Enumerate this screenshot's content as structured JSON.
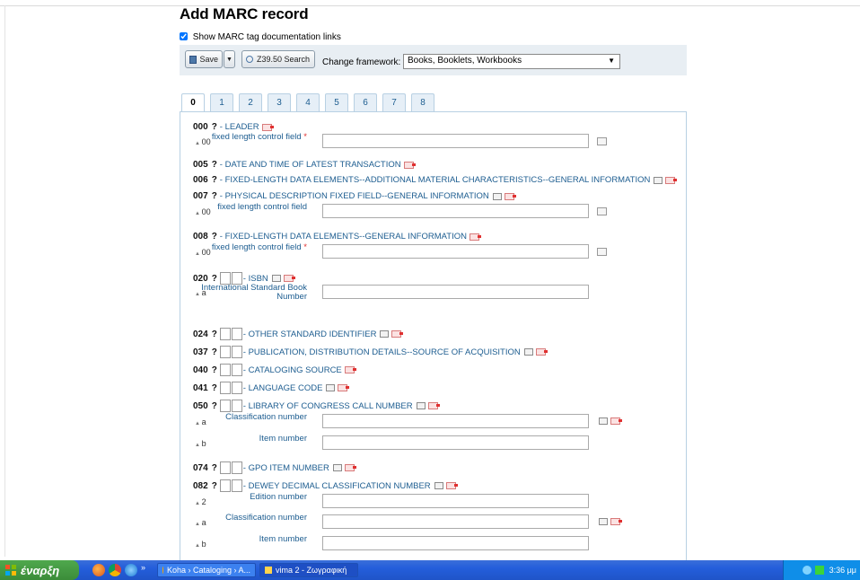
{
  "page": {
    "title": "Add MARC record",
    "show_doc_label": "Show MARC tag documentation links",
    "show_doc_checked": true
  },
  "toolbar": {
    "save_label": "Save",
    "z3950_label": "Z39.50 Search",
    "framework_label": "Change framework:",
    "framework_value": "Books, Booklets, Workbooks"
  },
  "tabs": [
    "0",
    "1",
    "2",
    "3",
    "4",
    "5",
    "6",
    "7",
    "8"
  ],
  "active_tab": "0",
  "fields": [
    {
      "tag": "000",
      "q": "?",
      "name": "- LEADER",
      "subs": [
        {
          "code": "00",
          "label": "fixed length control field",
          "required": true,
          "value": ""
        }
      ]
    },
    {
      "tag": "005",
      "q": "?",
      "name": "- DATE AND TIME OF LATEST TRANSACTION",
      "subs": []
    },
    {
      "tag": "006",
      "q": "?",
      "name": "- FIXED-LENGTH DATA ELEMENTS--ADDITIONAL MATERIAL CHARACTERISTICS--GENERAL INFORMATION",
      "subs": []
    },
    {
      "tag": "007",
      "q": "?",
      "name": "- PHYSICAL DESCRIPTION FIXED FIELD--GENERAL INFORMATION",
      "subs": [
        {
          "code": "00",
          "label": "fixed length control field",
          "required": false,
          "value": ""
        }
      ]
    },
    {
      "tag": "008",
      "q": "?",
      "name": "- FIXED-LENGTH DATA ELEMENTS--GENERAL INFORMATION",
      "subs": [
        {
          "code": "00",
          "label": "fixed length control field",
          "required": true,
          "value": ""
        }
      ]
    },
    {
      "tag": "020",
      "q": "?",
      "name": "- ISBN",
      "subs": [
        {
          "code": "a",
          "label": "International Standard Book Number",
          "value": ""
        }
      ]
    },
    {
      "tag": "024",
      "q": "?",
      "name": "- OTHER STANDARD IDENTIFIER",
      "subs": []
    },
    {
      "tag": "037",
      "q": "?",
      "name": "- PUBLICATION, DISTRIBUTION DETAILS--SOURCE OF ACQUISITION",
      "subs": []
    },
    {
      "tag": "040",
      "q": "?",
      "name": "- CATALOGING SOURCE",
      "subs": []
    },
    {
      "tag": "041",
      "q": "?",
      "name": "- LANGUAGE CODE",
      "subs": []
    },
    {
      "tag": "050",
      "q": "?",
      "name": "- LIBRARY OF CONGRESS CALL NUMBER",
      "subs": [
        {
          "code": "a",
          "label": "Classification number",
          "value": ""
        },
        {
          "code": "b",
          "label": "Item number",
          "value": ""
        }
      ]
    },
    {
      "tag": "074",
      "q": "?",
      "name": "- GPO ITEM NUMBER",
      "subs": []
    },
    {
      "tag": "082",
      "q": "?",
      "name": "- DEWEY DECIMAL CLASSIFICATION NUMBER",
      "subs": [
        {
          "code": "2",
          "label": "Edition number",
          "value": ""
        },
        {
          "code": "a",
          "label": "Classification number",
          "value": ""
        },
        {
          "code": "b",
          "label": "Item number",
          "value": ""
        }
      ]
    }
  ],
  "taskbar": {
    "start_label": "έναρξη",
    "task1": "Koha › Cataloging › A...",
    "task2": "vima 2 - Ζωγραφική",
    "clock": "3:36 μμ"
  },
  "colors": {
    "accent": "#1d5d90",
    "toolbar_bg": "#e8eef3",
    "taskbar": "#245edb",
    "start": "#3b8c39"
  }
}
